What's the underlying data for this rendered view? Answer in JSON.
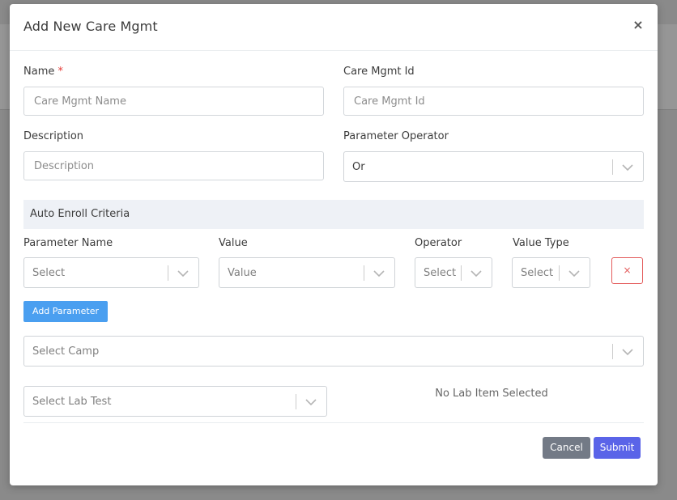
{
  "modal": {
    "title": "Add New Care Mgmt",
    "close_label": "×"
  },
  "fields": {
    "name": {
      "label": "Name",
      "required_mark": "*",
      "placeholder": "Care Mgmt Name",
      "value": ""
    },
    "care_mgmt_id": {
      "label": "Care Mgmt Id",
      "placeholder": "Care Mgmt Id",
      "value": ""
    },
    "description": {
      "label": "Description",
      "placeholder": "Description",
      "value": ""
    },
    "parameter_operator": {
      "label": "Parameter Operator",
      "value": "Or"
    }
  },
  "auto_enroll": {
    "title": "Auto Enroll Criteria",
    "columns": {
      "parameter_name": "Parameter Name",
      "value": "Value",
      "operator": "Operator",
      "value_type": "Value Type"
    },
    "row": {
      "parameter_name_placeholder": "Select",
      "value_placeholder": "Value",
      "operator_placeholder": "Select",
      "value_type_placeholder": "Select",
      "remove_label": "×"
    },
    "add_parameter_label": "Add Parameter"
  },
  "camp_select": {
    "placeholder": "Select Camp"
  },
  "lab_test_select": {
    "placeholder": "Select Lab Test"
  },
  "lab_status": "No Lab Item Selected",
  "footer": {
    "cancel_label": "Cancel",
    "submit_label": "Submit"
  },
  "colors": {
    "add_parameter_button": "#4a9ff0",
    "submit_button": "#5a64e8",
    "cancel_button": "#737a86",
    "remove_button_border": "#e35b5b",
    "required_mark": "#e53935"
  }
}
